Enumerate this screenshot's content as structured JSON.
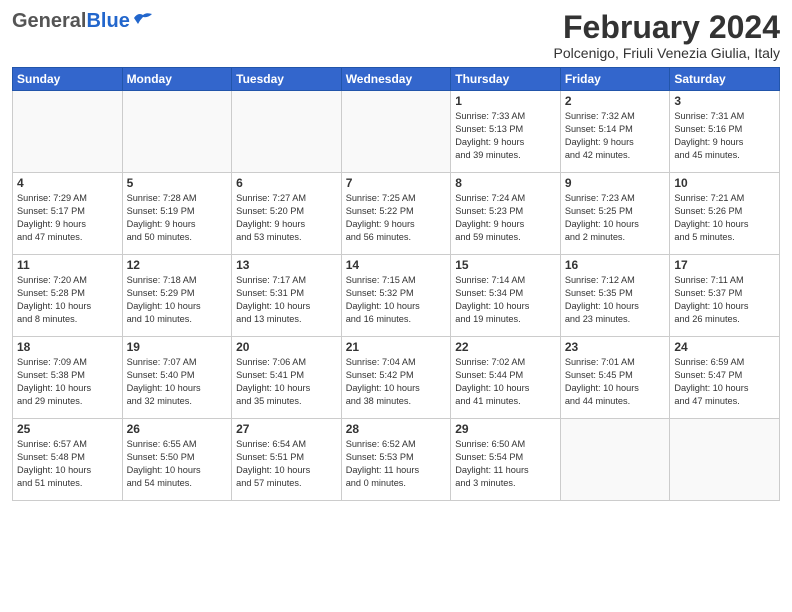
{
  "header": {
    "logo_general": "General",
    "logo_blue": "Blue",
    "month_title": "February 2024",
    "location": "Polcenigo, Friuli Venezia Giulia, Italy"
  },
  "weekdays": [
    "Sunday",
    "Monday",
    "Tuesday",
    "Wednesday",
    "Thursday",
    "Friday",
    "Saturday"
  ],
  "weeks": [
    [
      {
        "day": "",
        "info": ""
      },
      {
        "day": "",
        "info": ""
      },
      {
        "day": "",
        "info": ""
      },
      {
        "day": "",
        "info": ""
      },
      {
        "day": "1",
        "info": "Sunrise: 7:33 AM\nSunset: 5:13 PM\nDaylight: 9 hours\nand 39 minutes."
      },
      {
        "day": "2",
        "info": "Sunrise: 7:32 AM\nSunset: 5:14 PM\nDaylight: 9 hours\nand 42 minutes."
      },
      {
        "day": "3",
        "info": "Sunrise: 7:31 AM\nSunset: 5:16 PM\nDaylight: 9 hours\nand 45 minutes."
      }
    ],
    [
      {
        "day": "4",
        "info": "Sunrise: 7:29 AM\nSunset: 5:17 PM\nDaylight: 9 hours\nand 47 minutes."
      },
      {
        "day": "5",
        "info": "Sunrise: 7:28 AM\nSunset: 5:19 PM\nDaylight: 9 hours\nand 50 minutes."
      },
      {
        "day": "6",
        "info": "Sunrise: 7:27 AM\nSunset: 5:20 PM\nDaylight: 9 hours\nand 53 minutes."
      },
      {
        "day": "7",
        "info": "Sunrise: 7:25 AM\nSunset: 5:22 PM\nDaylight: 9 hours\nand 56 minutes."
      },
      {
        "day": "8",
        "info": "Sunrise: 7:24 AM\nSunset: 5:23 PM\nDaylight: 9 hours\nand 59 minutes."
      },
      {
        "day": "9",
        "info": "Sunrise: 7:23 AM\nSunset: 5:25 PM\nDaylight: 10 hours\nand 2 minutes."
      },
      {
        "day": "10",
        "info": "Sunrise: 7:21 AM\nSunset: 5:26 PM\nDaylight: 10 hours\nand 5 minutes."
      }
    ],
    [
      {
        "day": "11",
        "info": "Sunrise: 7:20 AM\nSunset: 5:28 PM\nDaylight: 10 hours\nand 8 minutes."
      },
      {
        "day": "12",
        "info": "Sunrise: 7:18 AM\nSunset: 5:29 PM\nDaylight: 10 hours\nand 10 minutes."
      },
      {
        "day": "13",
        "info": "Sunrise: 7:17 AM\nSunset: 5:31 PM\nDaylight: 10 hours\nand 13 minutes."
      },
      {
        "day": "14",
        "info": "Sunrise: 7:15 AM\nSunset: 5:32 PM\nDaylight: 10 hours\nand 16 minutes."
      },
      {
        "day": "15",
        "info": "Sunrise: 7:14 AM\nSunset: 5:34 PM\nDaylight: 10 hours\nand 19 minutes."
      },
      {
        "day": "16",
        "info": "Sunrise: 7:12 AM\nSunset: 5:35 PM\nDaylight: 10 hours\nand 23 minutes."
      },
      {
        "day": "17",
        "info": "Sunrise: 7:11 AM\nSunset: 5:37 PM\nDaylight: 10 hours\nand 26 minutes."
      }
    ],
    [
      {
        "day": "18",
        "info": "Sunrise: 7:09 AM\nSunset: 5:38 PM\nDaylight: 10 hours\nand 29 minutes."
      },
      {
        "day": "19",
        "info": "Sunrise: 7:07 AM\nSunset: 5:40 PM\nDaylight: 10 hours\nand 32 minutes."
      },
      {
        "day": "20",
        "info": "Sunrise: 7:06 AM\nSunset: 5:41 PM\nDaylight: 10 hours\nand 35 minutes."
      },
      {
        "day": "21",
        "info": "Sunrise: 7:04 AM\nSunset: 5:42 PM\nDaylight: 10 hours\nand 38 minutes."
      },
      {
        "day": "22",
        "info": "Sunrise: 7:02 AM\nSunset: 5:44 PM\nDaylight: 10 hours\nand 41 minutes."
      },
      {
        "day": "23",
        "info": "Sunrise: 7:01 AM\nSunset: 5:45 PM\nDaylight: 10 hours\nand 44 minutes."
      },
      {
        "day": "24",
        "info": "Sunrise: 6:59 AM\nSunset: 5:47 PM\nDaylight: 10 hours\nand 47 minutes."
      }
    ],
    [
      {
        "day": "25",
        "info": "Sunrise: 6:57 AM\nSunset: 5:48 PM\nDaylight: 10 hours\nand 51 minutes."
      },
      {
        "day": "26",
        "info": "Sunrise: 6:55 AM\nSunset: 5:50 PM\nDaylight: 10 hours\nand 54 minutes."
      },
      {
        "day": "27",
        "info": "Sunrise: 6:54 AM\nSunset: 5:51 PM\nDaylight: 10 hours\nand 57 minutes."
      },
      {
        "day": "28",
        "info": "Sunrise: 6:52 AM\nSunset: 5:53 PM\nDaylight: 11 hours\nand 0 minutes."
      },
      {
        "day": "29",
        "info": "Sunrise: 6:50 AM\nSunset: 5:54 PM\nDaylight: 11 hours\nand 3 minutes."
      },
      {
        "day": "",
        "info": ""
      },
      {
        "day": "",
        "info": ""
      }
    ]
  ]
}
